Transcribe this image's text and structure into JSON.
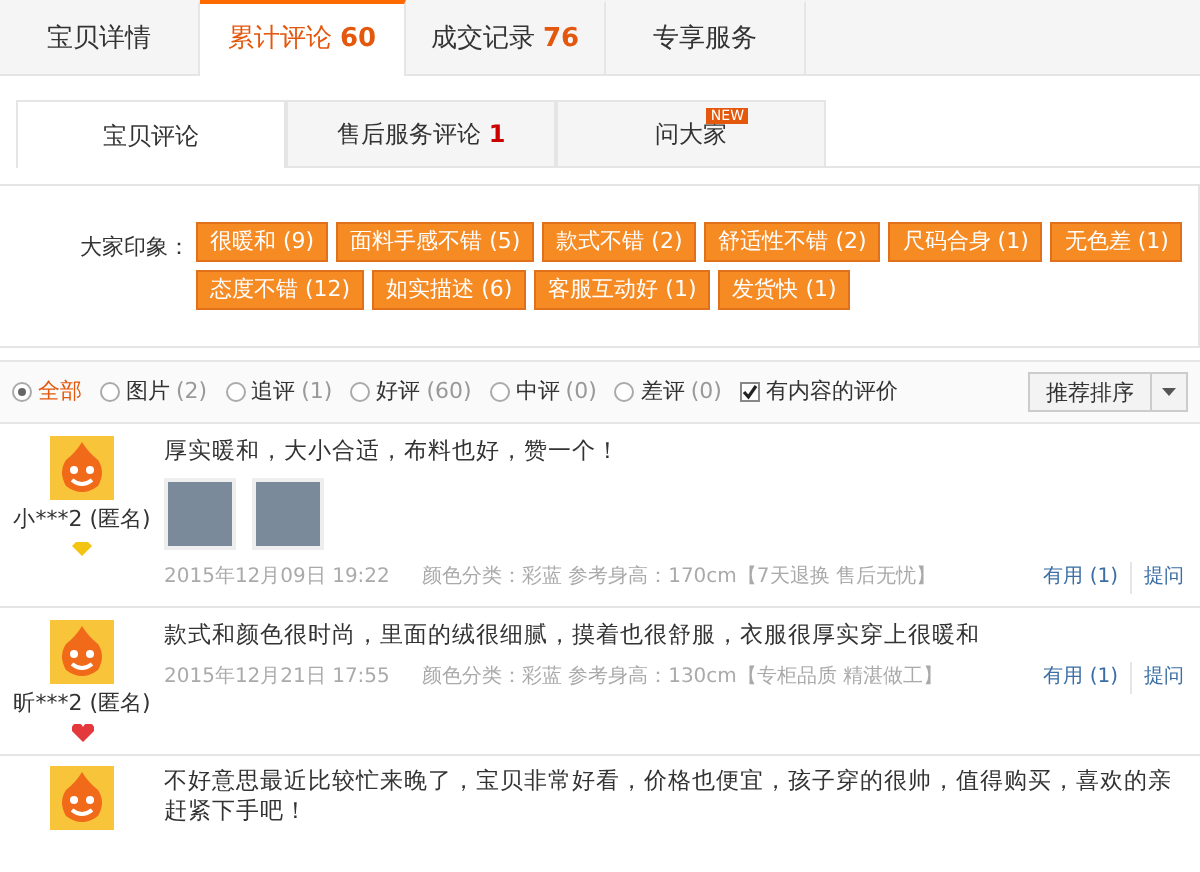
{
  "tabs": [
    {
      "label": "宝贝详情",
      "selected": false
    },
    {
      "label": "累计评论",
      "count": "60",
      "selected": true
    },
    {
      "label": "成交记录",
      "count": "76",
      "selected": false
    },
    {
      "label": "专享服务",
      "selected": false
    }
  ],
  "sub_tabs": [
    {
      "label": "宝贝评论",
      "selected": true
    },
    {
      "label": "售后服务评论",
      "count": "1",
      "selected": false
    },
    {
      "label": "问大家",
      "badge": "NEW",
      "selected": false
    }
  ],
  "impressions": {
    "label": "大家印象：",
    "tags": [
      "很暖和 (9)",
      "面料手感不错 (5)",
      "款式不错 (2)",
      "舒适性不错 (2)",
      "尺码合身 (1)",
      "无色差 (1)",
      "态度不错 (12)",
      "如实描述 (6)",
      "客服互动好 (1)",
      "发货快 (1)"
    ]
  },
  "filters": [
    {
      "kind": "radio",
      "label": "全部",
      "selected": true
    },
    {
      "kind": "radio",
      "label": "图片",
      "count": "(2)",
      "selected": false
    },
    {
      "kind": "radio",
      "label": "追评",
      "count": "(1)",
      "selected": false
    },
    {
      "kind": "radio",
      "label": "好评",
      "count": "(60)",
      "selected": false
    },
    {
      "kind": "radio",
      "label": "中评",
      "count": "(0)",
      "selected": false
    },
    {
      "kind": "radio",
      "label": "差评",
      "count": "(0)",
      "selected": false
    },
    {
      "kind": "checkbox",
      "label": "有内容的评价",
      "checked": true
    }
  ],
  "sort": {
    "label": "推荐排序"
  },
  "reviews": [
    {
      "user": "小***2 (匿名)",
      "badge": {
        "kind": "diamond"
      },
      "text": "厚实暖和，大小合适，布料也好，赞一个！",
      "photos": [
        {
          "kind": "photo"
        },
        {
          "kind": "photo"
        }
      ],
      "date": "2015年12月09日 19:22",
      "sku": "颜色分类：彩蓝   参考身高：170cm【7天退换 售后无忧】",
      "useful": "有用",
      "useful_count": "(1)",
      "reply": "提问"
    },
    {
      "user": "昕***2 (匿名)",
      "badge": {
        "kind": "heart"
      },
      "text": "款式和颜色很时尚，里面的绒很细腻，摸着也很舒服，衣服很厚实穿上很暖和",
      "date": "2015年12月21日 17:55",
      "sku": "颜色分类：彩蓝   参考身高：130cm【专柜品质 精湛做工】",
      "useful": "有用",
      "useful_count": "(1)",
      "reply": "提问"
    },
    {
      "text": "不好意思最近比较忙来晚了，宝贝非常好看，价格也便宜，孩子穿的很帅，值得购买，喜欢的亲赶紧下手吧！"
    }
  ]
}
